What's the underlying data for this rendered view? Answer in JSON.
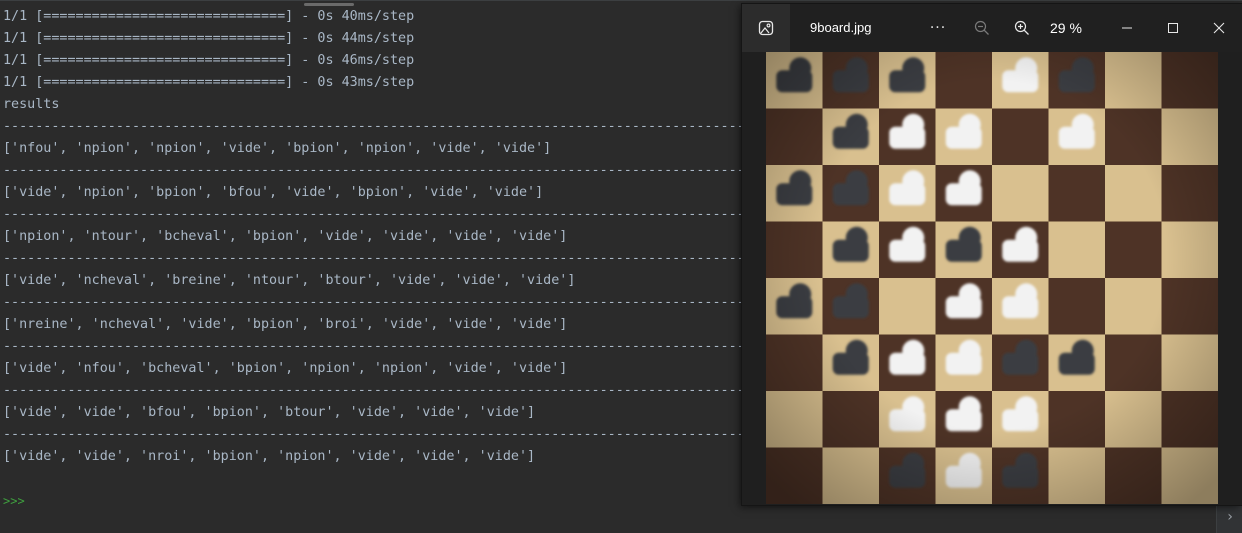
{
  "console": {
    "progress_lines": [
      "1/1 [==============================] - 0s 40ms/step",
      "1/1 [==============================] - 0s 44ms/step",
      "1/1 [==============================] - 0s 46ms/step",
      "1/1 [==============================] - 0s 43ms/step"
    ],
    "results_label": "results",
    "separator": "----------------------------------------------------------------------------------------------------",
    "rows": [
      "['nfou', 'npion', 'npion', 'vide', 'bpion', 'npion', 'vide', 'vide']",
      "['vide', 'npion', 'bpion', 'bfou', 'vide', 'bpion', 'vide', 'vide']",
      "['npion', 'ntour', 'bcheval', 'bpion', 'vide', 'vide', 'vide', 'vide']",
      "['vide', 'ncheval', 'breine', 'ntour', 'btour', 'vide', 'vide', 'vide']",
      "['nreine', 'ncheval', 'vide', 'bpion', 'broi', 'vide', 'vide', 'vide']",
      "['vide', 'nfou', 'bcheval', 'bpion', 'npion', 'npion', 'vide', 'vide']",
      "['vide', 'vide', 'bfou', 'bpion', 'btour', 'vide', 'vide', 'vide']",
      "['vide', 'vide', 'nroi', 'bpion', 'npion', 'vide', 'vide', 'vide']"
    ],
    "prompt": ">>>"
  },
  "viewer": {
    "filename": "9board.jpg",
    "more_label": "···",
    "zoom_level": "29 %",
    "icons": {
      "app": "photo-app-icon",
      "zoom_out": "zoom-out-icon",
      "zoom_in": "zoom-in-icon",
      "minimize": "minimize-icon",
      "maximize": "maximize-icon",
      "close": "close-icon"
    }
  },
  "colors": {
    "console_bg": "#2b2b2b",
    "console_text": "#a9b7c6",
    "prompt_green": "#3fa13f",
    "viewer_bg": "#202020"
  }
}
